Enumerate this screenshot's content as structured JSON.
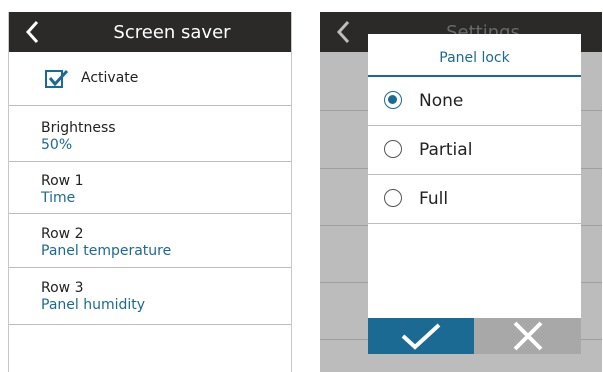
{
  "screen_saver": {
    "title": "Screen saver",
    "activate": {
      "label": "Activate",
      "checked": true
    },
    "brightness": {
      "label": "Brightness",
      "value": "50%"
    },
    "rows": [
      {
        "label": "Row 1",
        "value": "Time"
      },
      {
        "label": "Row 2",
        "value": "Panel temperature"
      },
      {
        "label": "Row 3",
        "value": "Panel humidity"
      }
    ]
  },
  "settings": {
    "title": "Settings",
    "panel_lock_dialog": {
      "title": "Panel lock",
      "options": [
        {
          "label": "None",
          "selected": true
        },
        {
          "label": "Partial",
          "selected": false
        },
        {
          "label": "Full",
          "selected": false
        }
      ],
      "confirm_icon": "checkmark-icon",
      "cancel_icon": "close-icon"
    }
  },
  "colors": {
    "header": "#2b2a29",
    "accent": "#1b6a93",
    "dim_overlay": "#bcbcbc",
    "cancel": "#a8a8a8"
  }
}
